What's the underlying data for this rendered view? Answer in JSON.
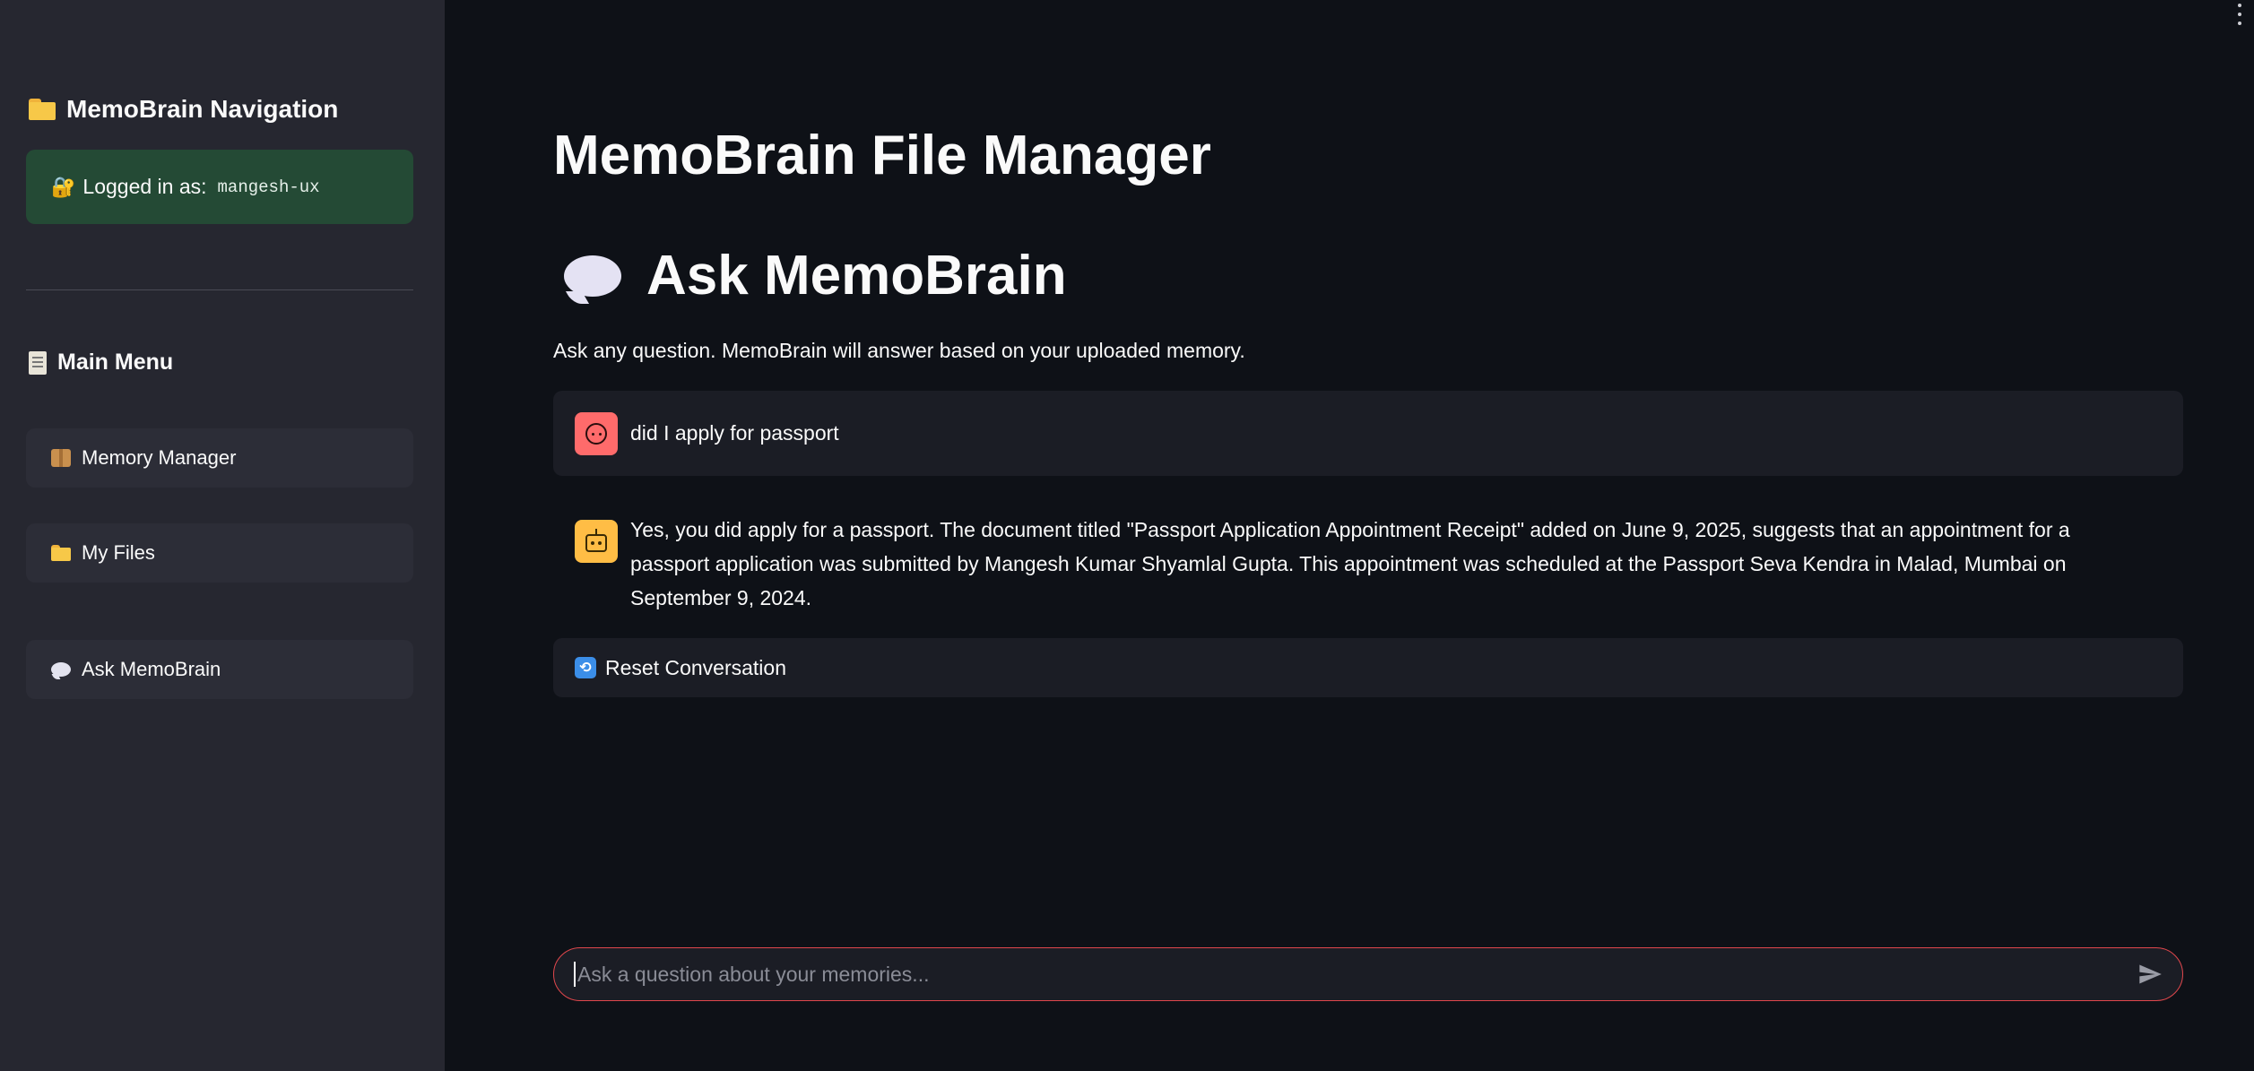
{
  "sidebar": {
    "nav_title": "MemoBrain Navigation",
    "login_label": "Logged in as:",
    "login_user": "mangesh-ux",
    "menu_title": "Main Menu",
    "items": [
      {
        "label": "Memory Manager",
        "icon": "package-icon"
      },
      {
        "label": "My Files",
        "icon": "folder-icon"
      },
      {
        "label": "Ask MemoBrain",
        "icon": "speech-bubble-icon"
      }
    ]
  },
  "main": {
    "page_title": "MemoBrain File Manager",
    "section_title": "Ask MemoBrain",
    "subtitle": "Ask any question. MemoBrain will answer based on your uploaded memory.",
    "messages": [
      {
        "role": "user",
        "text": "did I apply for passport"
      },
      {
        "role": "assistant",
        "text": "Yes, you did apply for a passport. The document titled \"Passport Application Appointment Receipt\" added on June 9, 2025, suggests that an appointment for a passport application was submitted by Mangesh Kumar Shyamlal Gupta. This appointment was scheduled at the Passport Seva Kendra in Malad, Mumbai on September 9, 2024."
      }
    ],
    "reset_label": "Reset Conversation",
    "chat_input": {
      "placeholder": "Ask a question about your memories...",
      "value": ""
    }
  },
  "colors": {
    "background": "#0e1117",
    "sidebar": "#262730",
    "login_box": "#244a35",
    "user_avatar": "#ff6b6b",
    "bot_avatar": "#ffbd45",
    "input_border": "#e0474c"
  }
}
